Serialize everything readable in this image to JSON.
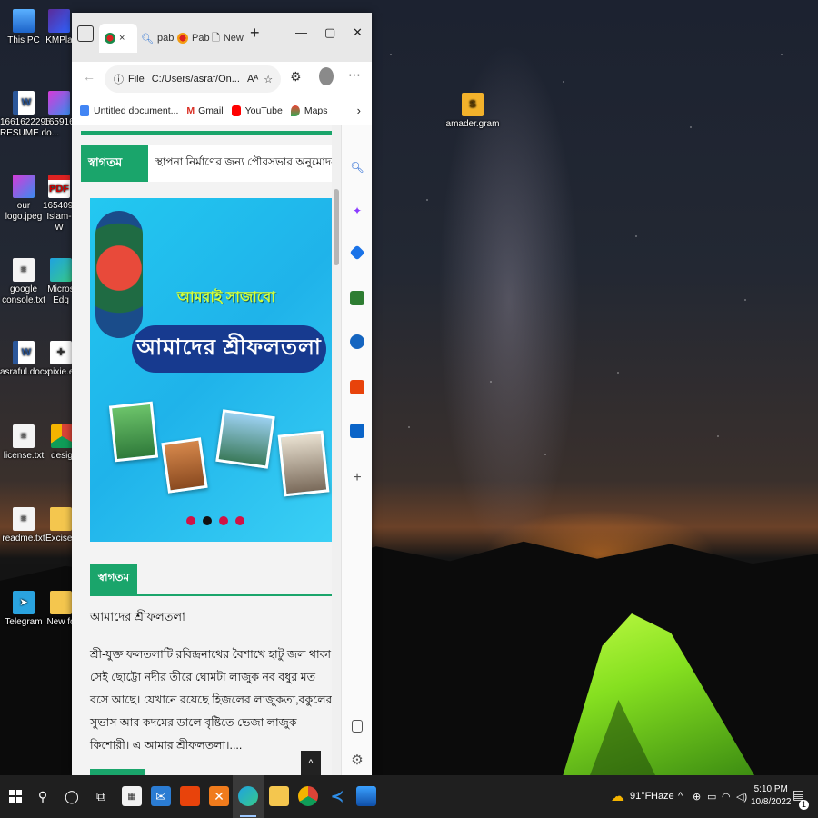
{
  "desktop": {
    "icons": [
      {
        "label": "This PC",
        "icon": "computer-icon"
      },
      {
        "label": "KMPla",
        "icon": "kmplayer-icon"
      },
      {
        "label": "1661622295... RESUME.do...",
        "icon": "word-document-icon"
      },
      {
        "label": "165916",
        "icon": "image-file-icon"
      },
      {
        "label": "our logo.jpeg",
        "icon": "image-file-icon"
      },
      {
        "label": "1654092... Islam-W",
        "icon": "pdf-file-icon"
      },
      {
        "label": "google console.txt",
        "icon": "text-file-icon"
      },
      {
        "label": "Micros Edg",
        "icon": "edge-icon"
      },
      {
        "label": "asraful.docx",
        "icon": "word-document-icon"
      },
      {
        "label": "pixie.e",
        "icon": "pixie-icon"
      },
      {
        "label": "license.txt",
        "icon": "text-file-icon"
      },
      {
        "label": "desig",
        "icon": "chrome-file-icon"
      },
      {
        "label": "readme.txt",
        "icon": "text-file-icon"
      },
      {
        "label": "Excise_",
        "icon": "folder-icon"
      },
      {
        "label": "Telegram",
        "icon": "telegram-icon"
      },
      {
        "label": "New fo",
        "icon": "folder-icon"
      },
      {
        "label": "amader.gram",
        "icon": "sublime-file-icon"
      }
    ]
  },
  "browser": {
    "tabs": [
      {
        "label": "×",
        "icon": "site-favicon"
      },
      {
        "label": "pab",
        "icon": "search-icon"
      },
      {
        "label": "Pab",
        "icon": "site-favicon"
      },
      {
        "label": "New",
        "icon": "page-icon"
      }
    ],
    "new_tab": "+",
    "window_controls": {
      "minimize": "—",
      "maximize": "▢",
      "close": "✕"
    },
    "address": {
      "scheme": "File",
      "url": "C:/Users/asraf/On..."
    },
    "reader_glyph": "Aᴬ",
    "bookmarks": [
      {
        "label": "Untitled document...",
        "icon": "google-docs-icon"
      },
      {
        "label": "Gmail",
        "icon": "gmail-icon"
      },
      {
        "label": "YouTube",
        "icon": "youtube-icon"
      },
      {
        "label": "Maps",
        "icon": "maps-icon"
      }
    ],
    "bookmarks_more": "›"
  },
  "page": {
    "notice_label": "স্বাগতম",
    "notice_text": "স্থাপনা নির্মাণের জন্য পৌরসভার অনুমোদন গ্রহণ ব",
    "banner_tagline": "আমরাই সাজাবো",
    "banner_title": "আমাদের শ্রীফলতলা",
    "slider_active_index": 1,
    "slider_count": 4,
    "welcome_tab": "স্বাগতম",
    "welcome_sub": "আমাদের শ্রীফলতলা",
    "welcome_body": "শ্রী-যুক্ত ফলতলাটি রবিন্দ্রনাথের বৈশাখে হাটু জল থাকা সেই ছোট্টো নদীর তীরে ঘোমটা লাজুক নব বধুর মত বসে আছে। যেখানে রয়েছে হিজলের লাজুকতা,বকুলের সুভাস আর কদমের ডালে বৃষ্টিতে ভেজা লাজুক কিশোরী। এ আমার শ্রীফলতলা।....",
    "scroll_top": "^"
  },
  "taskbar": {
    "weather_temp": "91°F",
    "weather_cond": "Haze",
    "time": "5:10 PM",
    "date": "10/8/2022",
    "notification_count": "1"
  }
}
